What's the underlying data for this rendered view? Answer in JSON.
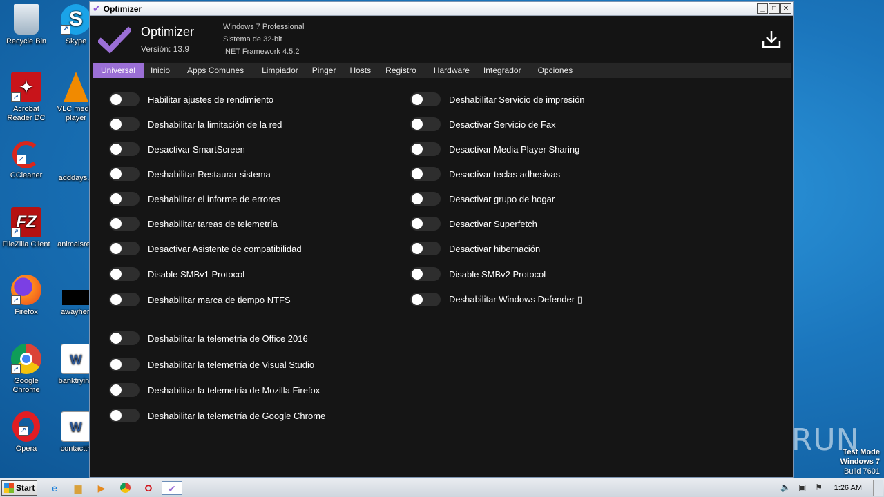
{
  "desktop": {
    "icons": [
      {
        "label": "Recycle Bin",
        "icon": "recycle-bin-icon"
      },
      {
        "label": "Skype",
        "icon": "skype-icon"
      },
      {
        "label": "Acrobat Reader DC",
        "icon": "acrobat-icon"
      },
      {
        "label": "VLC media player",
        "icon": "vlc-icon"
      },
      {
        "label": "CCleaner",
        "icon": "ccleaner-icon"
      },
      {
        "label": "adddays.p",
        "icon": "document-icon"
      },
      {
        "label": "FileZilla Client",
        "icon": "filezilla-icon"
      },
      {
        "label": "animalsreg",
        "icon": "document-icon"
      },
      {
        "label": "Firefox",
        "icon": "firefox-icon"
      },
      {
        "label": "awayher.",
        "icon": "black-file-icon"
      },
      {
        "label": "Google Chrome",
        "icon": "chrome-icon"
      },
      {
        "label": "banktrying",
        "icon": "word-icon"
      },
      {
        "label": "Opera",
        "icon": "opera-icon"
      },
      {
        "label": "contactth",
        "icon": "word-icon"
      }
    ],
    "watermark": "ANY RUN",
    "test_mode": {
      "line1": "Test Mode",
      "line2": "Windows 7",
      "line3": "Build 7601"
    }
  },
  "window": {
    "title": "Optimizer",
    "app_name": "Optimizer",
    "version": "Versión: 13.9",
    "os": "Windows 7 Professional",
    "arch": "Sistema de 32-bit",
    "framework": ".NET Framework 4.5.2",
    "accent": "#9b6fd6"
  },
  "tabs": [
    "Universal",
    "Inicio",
    "Apps Comunes",
    "Limpiador",
    "Pinger",
    "Hosts",
    "Registro",
    "Hardware",
    "Integrador",
    "Opciones"
  ],
  "active_tab": "Universal",
  "left_toggles": [
    "Habilitar ajustes de rendimiento",
    "Deshabilitar la limitación de la red",
    "Desactivar SmartScreen",
    "Deshabilitar Restaurar sistema",
    "Deshabilitar el informe de errores",
    "Deshabilitar tareas de telemetría",
    "Desactivar Asistente de compatibilidad",
    "Disable SMBv1 Protocol",
    "Deshabilitar marca de tiempo NTFS"
  ],
  "left_toggles_2": [
    "Deshabilitar la telemetría de Office 2016",
    "Deshabilitar la telemetría de Visual Studio",
    "Deshabilitar la telemetría de Mozilla Firefox",
    "Deshabilitar la telemetría de Google Chrome"
  ],
  "right_toggles": [
    "Deshabilitar Servicio de impresión",
    "Desactivar Servicio de Fax",
    "Desactivar Media Player Sharing",
    "Desactivar teclas adhesivas",
    "Desactivar grupo de hogar",
    "Desactivar Superfetch",
    "Desactivar hibernación",
    "Disable SMBv2 Protocol",
    "Deshabilitar Windows Defender ▯"
  ],
  "taskbar": {
    "start_label": "Start",
    "clock": "1:26 AM"
  }
}
